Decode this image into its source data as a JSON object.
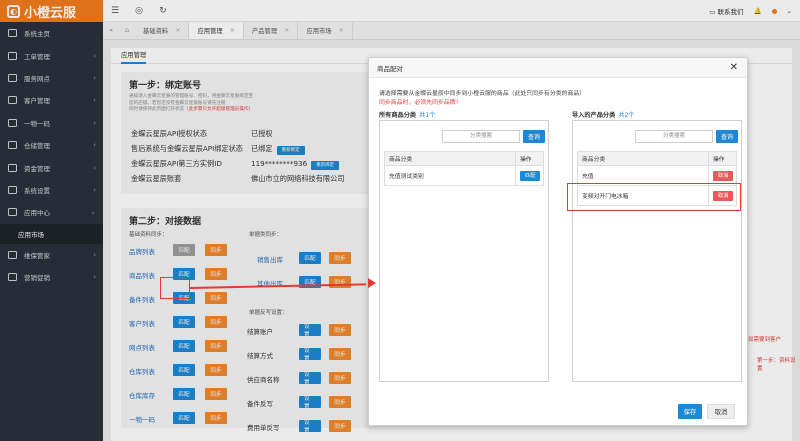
{
  "brand": {
    "logo_text": "小橙云服",
    "accent": "#f07c1e"
  },
  "sidebar": {
    "items": [
      {
        "label": "系统主页",
        "icon": "monitor-icon"
      },
      {
        "label": "工单管理",
        "icon": "document-icon",
        "chevron": "‹"
      },
      {
        "label": "服务网点",
        "icon": "location-icon",
        "chevron": "‹"
      },
      {
        "label": "客户管理",
        "icon": "user-icon",
        "chevron": "‹"
      },
      {
        "label": "一物一码",
        "icon": "grid-icon",
        "chevron": "‹"
      },
      {
        "label": "仓储管理",
        "icon": "warehouse-icon",
        "chevron": "‹"
      },
      {
        "label": "资金管理",
        "icon": "money-icon",
        "chevron": "‹"
      },
      {
        "label": "系统设置",
        "icon": "gear-icon",
        "chevron": "‹"
      },
      {
        "label": "应用中心",
        "icon": "apps-icon",
        "chevron": "⌄"
      }
    ],
    "sub_item": "应用市场",
    "items_after": [
      {
        "label": "维保管家",
        "icon": "tool-icon",
        "chevron": "‹"
      },
      {
        "label": "营销促销",
        "icon": "promo-icon",
        "chevron": "‹"
      }
    ]
  },
  "topbar": {
    "service_label": "联系我们",
    "tabs": [
      {
        "label": "基础资料",
        "active": false
      },
      {
        "label": "应用管理",
        "active": true
      },
      {
        "label": "产品管理",
        "active": false
      },
      {
        "label": "应用市场",
        "active": false
      }
    ]
  },
  "background": {
    "panel_tab": "应用管理",
    "step1": {
      "title": "第一步：绑定账号",
      "desc1": "通知请入金蝶云星辰的管理账号、密码，将金蝶云星辰绑定至",
      "desc2": "您的店铺。若您还没有金蝶云星辰账号请先注册",
      "desc3": "同时请保持此页面打开状态",
      "warn": "（此步骤只允许超级管理员操作）",
      "rows": [
        {
          "k": "金蝶云星辰API授权状态",
          "v": "已授权",
          "btn": ""
        },
        {
          "k": "售后系统与金蝶云星辰API绑定状态",
          "v": "已绑定",
          "btn": "重新绑定"
        },
        {
          "k": "金蝶云星辰API第三方实例ID",
          "v": "119********936",
          "btn": "重新绑定"
        },
        {
          "k": "金蝶云星辰账套",
          "v": "佛山市立的网络科技有限公司",
          "btn": ""
        }
      ]
    },
    "step2": {
      "title": "第二步：对接数据",
      "left_sub": "基础资料同步：",
      "right_sub": "单据类同步：",
      "right_sub2": "单据反写设置：",
      "left_rows": [
        "品牌列表",
        "商品列表",
        "备件列表",
        "客户列表",
        "网点列表",
        "仓库列表",
        "仓库库存",
        "一物一码"
      ],
      "right_rows": [
        "销售出库",
        "其他出库",
        "结算账户",
        "结算方式",
        "供应商名称",
        "备件反写",
        "费用单反写"
      ],
      "btn_match": "匹配",
      "btn_sync": "同步",
      "btn_setting": "设 置"
    },
    "right_notes": [
      "如需要到客户",
      "第一步：资料设置"
    ]
  },
  "modal": {
    "title": "商品配对",
    "desc": "请选择需要从金蝶云星辰中同步到小橙云服的商品（此处只同步有分类的商品）",
    "warn": "同步商品时，必须先同步品牌！",
    "left": {
      "title": "所有商品分类",
      "count": "共1个",
      "search_placeholder": "分类搜索",
      "search_btn": "查询",
      "col_category": "商品分类",
      "col_action": "操作",
      "rows": [
        {
          "name": "充值测试类别",
          "action": "匹配"
        }
      ]
    },
    "right": {
      "title": "导入的产品分类",
      "count": "共2个",
      "search_placeholder": "分类搜索",
      "search_btn": "查询",
      "col_category": "商品分类",
      "col_action": "操作",
      "rows": [
        {
          "name": "充值",
          "action": "取消"
        },
        {
          "name": "变频对开门电冰箱",
          "action": "取消"
        }
      ]
    },
    "save": "保存",
    "cancel": "取消"
  }
}
